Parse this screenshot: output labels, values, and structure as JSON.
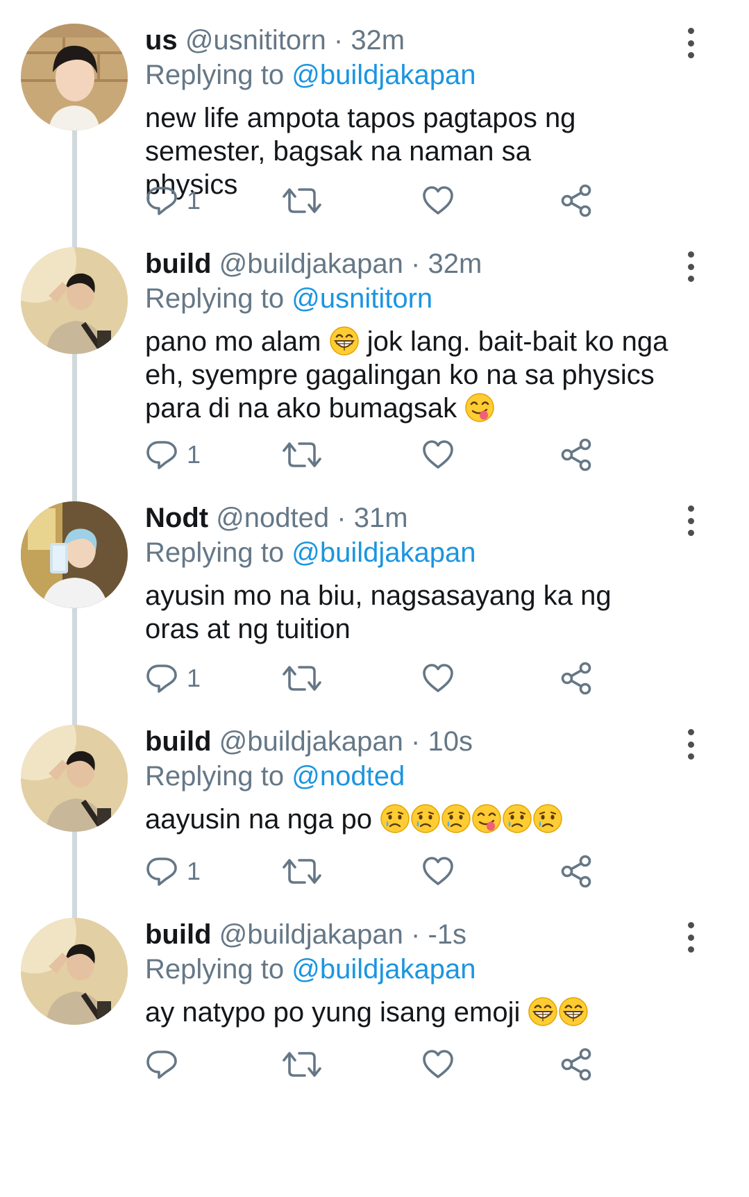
{
  "colors": {
    "link": "#1b95e0",
    "secondary_text": "#657786",
    "primary_text": "#14171a",
    "thread_line": "#cfd9de"
  },
  "tweets": [
    {
      "name": "us",
      "handle": "@usnititorn",
      "time": "32m",
      "replying_label": "Replying to",
      "replying_to": "@buildjakapan",
      "text": "new life ampota tapos pagtapos ng semester, bagsak na naman sa physics",
      "reply_count": "1",
      "emojis": []
    },
    {
      "name": "build",
      "handle": "@buildjakapan",
      "time": "32m",
      "replying_label": "Replying to",
      "replying_to": "@usnititorn",
      "text_part1": "pano mo alam ",
      "text_part2": " jok lang. bait-bait ko nga eh, syempre gagalingan ko na sa physics para di na ako bumagsak ",
      "reply_count": "1",
      "emojis": [
        "grin-emoji",
        "yum-emoji"
      ]
    },
    {
      "name": "Nodt",
      "handle": "@nodted",
      "time": "31m",
      "replying_label": "Replying to",
      "replying_to": "@buildjakapan",
      "text": "ayusin mo na biu, nagsasayang ka ng oras at ng tuition",
      "reply_count": "1",
      "emojis": []
    },
    {
      "name": "build",
      "handle": "@buildjakapan",
      "time": "10s",
      "replying_label": "Replying to",
      "replying_to": "@nodted",
      "text": "aayusin na nga po ",
      "reply_count": "1",
      "emojis": [
        "cry-emoji",
        "cry-emoji",
        "cry-emoji",
        "yum-emoji",
        "cry-emoji",
        "cry-emoji"
      ]
    },
    {
      "name": "build",
      "handle": "@buildjakapan",
      "time": "-1s",
      "replying_label": "Replying to",
      "replying_to": "@buildjakapan",
      "text": "ay natypo po yung isang emoji ",
      "reply_count": "",
      "emojis": [
        "grin-emoji",
        "grin-emoji"
      ]
    }
  ],
  "dot_separator": "·",
  "icons": [
    "reply-icon",
    "retweet-icon",
    "like-icon",
    "share-icon",
    "more-icon"
  ]
}
